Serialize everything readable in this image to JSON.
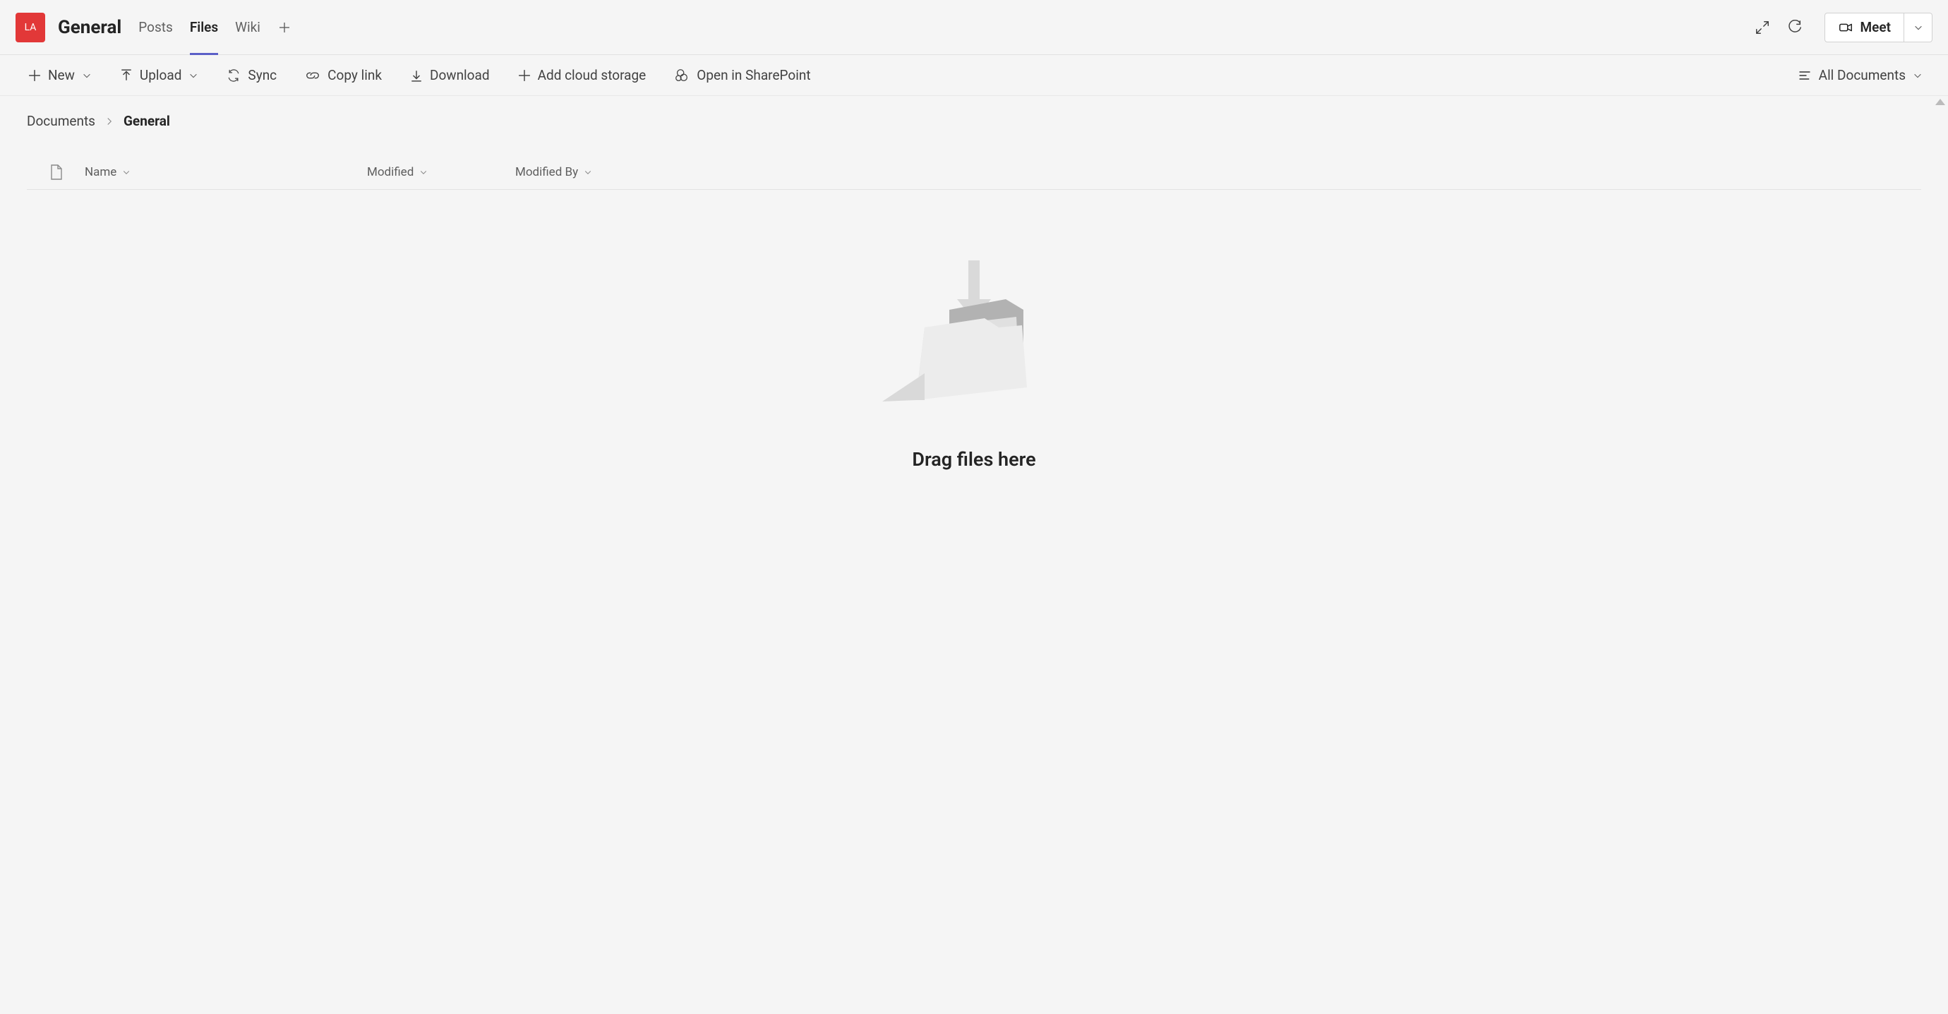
{
  "header": {
    "avatar_initials": "LA",
    "channel_name": "General",
    "tabs": [
      {
        "label": "Posts",
        "active": false
      },
      {
        "label": "Files",
        "active": true
      },
      {
        "label": "Wiki",
        "active": false
      }
    ],
    "meet_label": "Meet"
  },
  "command_bar": {
    "new_label": "New",
    "upload_label": "Upload",
    "sync_label": "Sync",
    "copy_link_label": "Copy link",
    "download_label": "Download",
    "add_cloud_label": "Add cloud storage",
    "sharepoint_label": "Open in SharePoint",
    "view_label": "All Documents"
  },
  "breadcrumb": {
    "root": "Documents",
    "current": "General"
  },
  "columns": {
    "name": "Name",
    "modified": "Modified",
    "modified_by": "Modified By"
  },
  "files": [],
  "empty_state_text": "Drag files here"
}
